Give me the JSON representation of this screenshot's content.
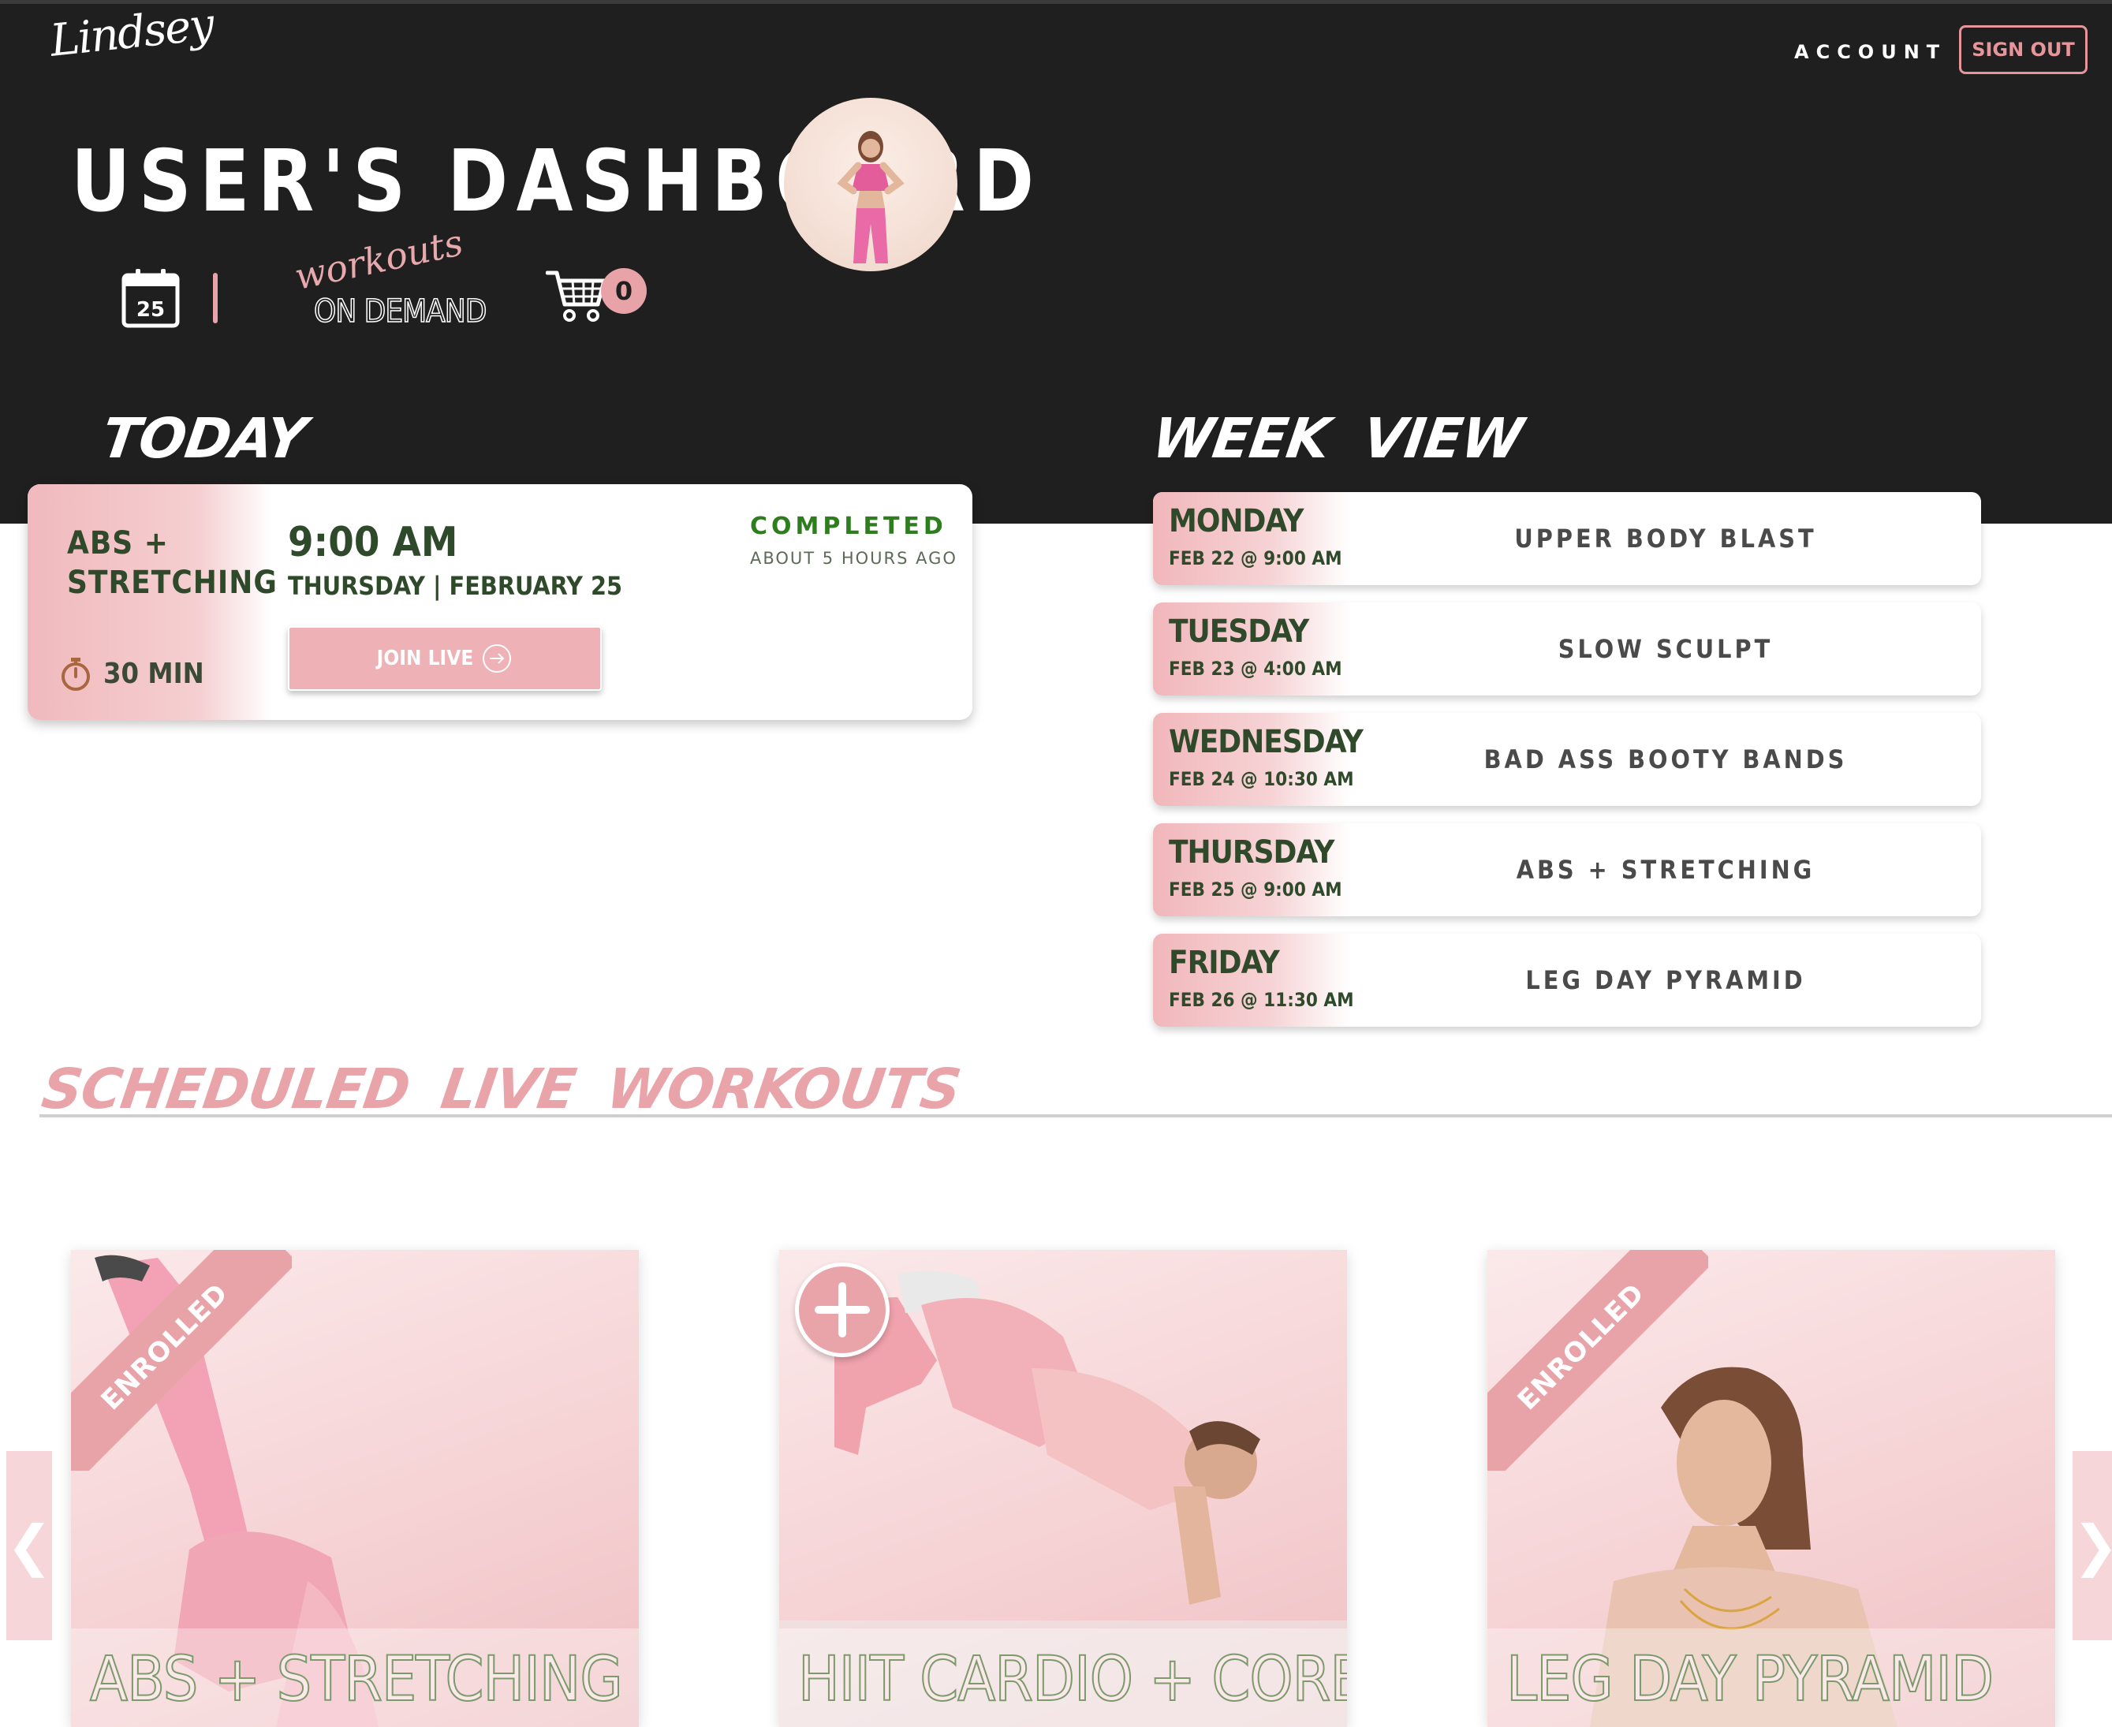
{
  "header": {
    "brand": "Lindsey",
    "account_label": "ACCOUNT",
    "signout_label": "SIGN OUT",
    "page_title": "USER'S DASHBOARD",
    "calendar_day": "25",
    "ondemand_script": "workouts",
    "ondemand_text": "ON DEMAND",
    "cart_count": "0"
  },
  "today": {
    "heading": "TODAY",
    "class_name": "ABS + STRETCHING",
    "duration": "30 MIN",
    "time": "9:00 AM",
    "date": "THURSDAY | FEBRUARY 25",
    "join_label": "JOIN LIVE",
    "status": "COMPLETED",
    "status_time": "ABOUT 5 HOURS AGO"
  },
  "week": {
    "heading": "WEEK VIEW",
    "days": [
      {
        "day": "MONDAY",
        "date": "FEB 22 @ 9:00 AM",
        "class": "UPPER BODY BLAST"
      },
      {
        "day": "TUESDAY",
        "date": "FEB 23 @ 4:00 AM",
        "class": "SLOW SCULPT"
      },
      {
        "day": "WEDNESDAY",
        "date": "FEB 24 @ 10:30 AM",
        "class": "BAD ASS BOOTY BANDS"
      },
      {
        "day": "THURSDAY",
        "date": "FEB 25 @ 9:00 AM",
        "class": "ABS + STRETCHING"
      },
      {
        "day": "FRIDAY",
        "date": "FEB 26 @ 11:30 AM",
        "class": "LEG DAY PYRAMID"
      }
    ]
  },
  "scheduled": {
    "heading": "SCHEDULED LIVE WORKOUTS",
    "prev_icon": "chevron-left-icon",
    "next_icon": "chevron-right-icon",
    "prev_glyph": "❮",
    "next_glyph": "❯",
    "cards": [
      {
        "title": "ABS + STRETCHING",
        "ribbon": "ENROLLED"
      },
      {
        "title": "HIIT CARDIO + CORE",
        "ribbon": ""
      },
      {
        "title": "LEG DAY PYRAMID",
        "ribbon": "ENROLLED"
      }
    ]
  },
  "colors": {
    "header_bg": "#1f1f1f",
    "accent_pink": "#e8a3a8",
    "text_green": "#2f4a2b",
    "status_green": "#2e7d1f"
  }
}
